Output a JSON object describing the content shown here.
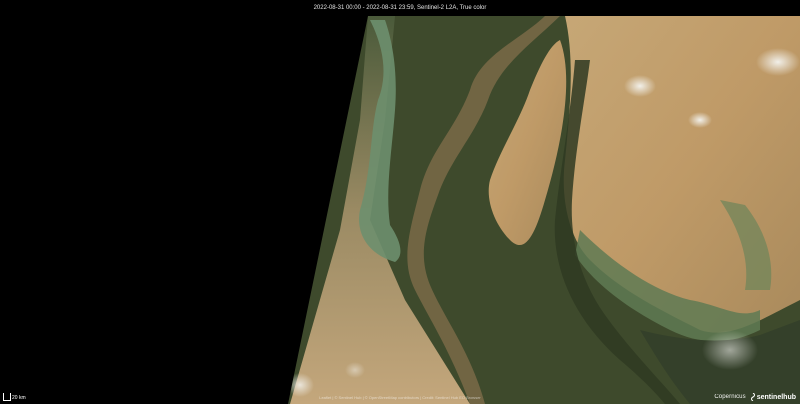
{
  "header": {
    "caption": "2022-08-31 00:00 - 2022-08-31 23:59, Sentinel-2 L2A, True color"
  },
  "scale": {
    "label": "20 km"
  },
  "attribution": {
    "text": "Leaflet | © Sentinel Hub | © OpenStreetMap contributors | Credit: Sentinel Hub EO Browser"
  },
  "logos": {
    "copernicus": "Copernicus",
    "sentinelhub": "sentinelhub"
  },
  "colors": {
    "nodata": "#000000",
    "desert": "#c9a574",
    "vegetation": "#3c4628",
    "floodwater": "#6f8f72",
    "cloud": "#e8e8e4"
  }
}
